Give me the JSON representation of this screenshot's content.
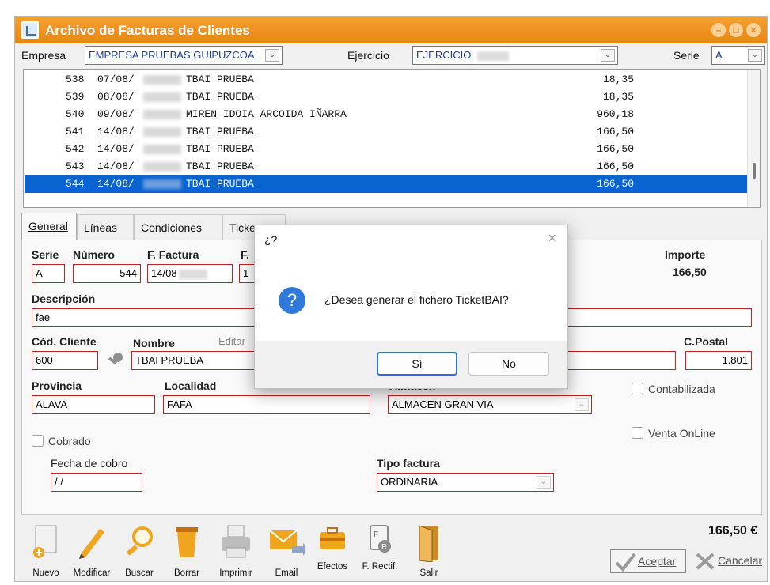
{
  "window": {
    "title": "Archivo de Facturas de Clientes"
  },
  "topbar": {
    "empresa_label": "Empresa",
    "empresa_value": "EMPRESA PRUEBAS GUIPUZCOA",
    "ejercicio_label": "Ejercicio",
    "ejercicio_value": "EJERCICIO",
    "serie_label": "Serie",
    "serie_value": "A"
  },
  "invoices": [
    {
      "num": "538",
      "date": "07/08/",
      "name": "TBAI PRUEBA",
      "amount": "18,35"
    },
    {
      "num": "539",
      "date": "08/08/",
      "name": "TBAI PRUEBA",
      "amount": "18,35"
    },
    {
      "num": "540",
      "date": "09/08/",
      "name": "MIREN IDOIA ARCOIDA IÑARRA",
      "amount": "960,18"
    },
    {
      "num": "541",
      "date": "14/08/",
      "name": "TBAI PRUEBA",
      "amount": "166,50"
    },
    {
      "num": "542",
      "date": "14/08/",
      "name": "TBAI PRUEBA",
      "amount": "166,50"
    },
    {
      "num": "543",
      "date": "14/08/",
      "name": "TBAI PRUEBA",
      "amount": "166,50"
    },
    {
      "num": "544",
      "date": "14/08/",
      "name": "TBAI PRUEBA",
      "amount": "166,50"
    }
  ],
  "tabs": [
    "General",
    "Líneas",
    "Condiciones",
    "Ticke"
  ],
  "form": {
    "serie_label": "Serie",
    "serie": "A",
    "numero_label": "Número",
    "numero": "544",
    "ffactura_label": "F. Factura",
    "ffactura": "14/08",
    "f2_label": "F.",
    "f2": "1",
    "importe_label": "Importe",
    "importe": "166,50",
    "descripcion_label": "Descripción",
    "descripcion": "fae",
    "codcliente_label": "Cód. Cliente",
    "codcliente": "600",
    "nombre_label": "Nombre",
    "editar_label": "Editar",
    "nombre": "TBAI PRUEBA",
    "cpostal_label": "C.Postal",
    "cpostal": "1.801",
    "provincia_label": "Provincia",
    "provincia": "ALAVA",
    "localidad_label": "Localidad",
    "localidad": "FAFA",
    "almacen_label": "Almacen",
    "almacen": "ALMACEN GRAN VIA",
    "contabilizada_label": "Contabilizada",
    "venta_online_label": "Venta OnLine",
    "cobrado_label": "Cobrado",
    "fecha_cobro_label": "Fecha de cobro",
    "fecha_cobro": "/ /",
    "tipo_factura_label": "Tipo factura",
    "tipo_factura": "ORDINARIA"
  },
  "toolbar": {
    "nuevo": "Nuevo",
    "modificar": "Modificar",
    "buscar": "Buscar",
    "borrar": "Borrar",
    "imprimir": "Imprimir",
    "email": "Email",
    "efectos": "Efectos",
    "rectif": "F. Rectif.",
    "salir": "Salir",
    "total": "166,50 €",
    "aceptar": "Aceptar",
    "cancelar": "Cancelar"
  },
  "dialog": {
    "title": "¿?",
    "message": "¿Desea generar el fichero TicketBAI?",
    "yes": "Sí",
    "no": "No"
  },
  "colors": {
    "titlebar": "#f39a2a",
    "selection": "#0a64d0",
    "field_border": "#c2231f",
    "dialog_primary": "#2b6ed8"
  }
}
